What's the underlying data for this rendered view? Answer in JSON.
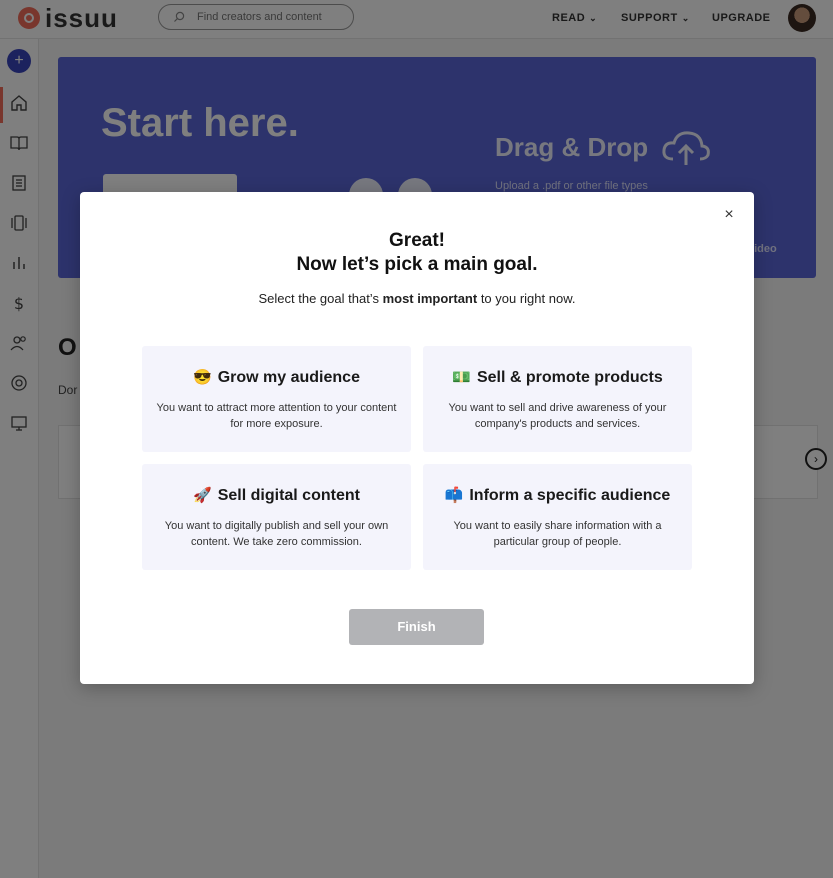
{
  "header": {
    "logo_text": "issuu",
    "search_placeholder": "Find creators and content",
    "nav": [
      {
        "label": "READ",
        "has_dropdown": true
      },
      {
        "label": "SUPPORT",
        "has_dropdown": true
      },
      {
        "label": "UPGRADE",
        "has_dropdown": false
      }
    ]
  },
  "sidebar": {
    "create_label": "+",
    "icons": [
      "home-icon",
      "book-icon",
      "articles-icon",
      "stories-icon",
      "stats-icon",
      "dollar-icon",
      "people-icon",
      "help-icon",
      "monitor-icon"
    ]
  },
  "hero": {
    "title": "Start here.",
    "drag_drop": "Drag & Drop",
    "upload_hint": "Upload a .pdf or other file types",
    "video_link": "video"
  },
  "section": {
    "title": "O",
    "subtitle": "Dor"
  },
  "strip": {
    "next_label": "›"
  },
  "modal": {
    "close_label": "×",
    "title_line1": "Great!",
    "title_line2": "Now let’s pick a main goal.",
    "subtitle_before": "Select the goal that’s ",
    "subtitle_bold": "most important",
    "subtitle_after": " to you right now.",
    "cards": [
      {
        "emoji": "😎",
        "title": "Grow my audience",
        "desc": "You want to attract more attention to your content for more exposure."
      },
      {
        "emoji": "💵",
        "title": "Sell & promote products",
        "desc": "You want to sell and drive awareness of your company's products and services."
      },
      {
        "emoji": "🚀",
        "title": "Sell digital content",
        "desc": "You want to digitally publish and sell your own content. We take zero commission."
      },
      {
        "emoji": "📫",
        "title": "Inform a specific audience",
        "desc": "You want to easily share information with a particular group of people."
      }
    ],
    "finish_label": "Finish"
  },
  "colors": {
    "brand": "#f36d5a",
    "primary": "#3944bc",
    "hero_bg": "#5a66d8",
    "card_bg": "#f4f4fc",
    "finish_disabled": "#b2b3b6"
  }
}
